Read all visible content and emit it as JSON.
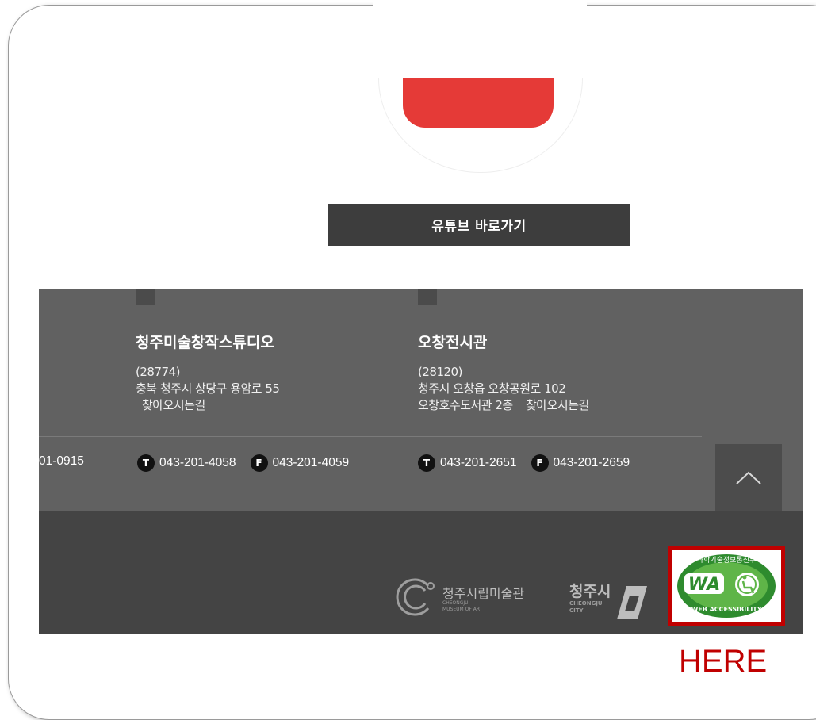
{
  "youtube": {
    "button_label": "유튜브 바로가기"
  },
  "venues": [
    {
      "name": "청주미술창작스튜디오",
      "postcode": "(28774)",
      "address_line": "충북 청주시 상당구 용암로 55",
      "directions": "찾아오시는길"
    },
    {
      "name": "오창전시관",
      "postcode": "(28120)",
      "address_line": "청주시 오창읍 오창공원로 102",
      "address_line2": "오창호수도서관 2층",
      "directions": "찾아오시는길"
    }
  ],
  "contacts": {
    "partial": "01-0915",
    "studio": {
      "tel": "043-201-4058",
      "fax": "043-201-4059"
    },
    "ochang": {
      "tel": "043-201-2651",
      "fax": "043-201-2659"
    },
    "tel_badge": "T",
    "fax_badge": "F"
  },
  "logos": {
    "museum_name": "청주시립미술관",
    "museum_en_1": "CHEONGJU",
    "museum_en_2": "MUSEUM OF ART",
    "city_name": "청주시",
    "city_en_1": "CHEONGJU",
    "city_en_2": "CITY"
  },
  "wa_mark": {
    "top_text": "과학기술정보통신부",
    "bottom_text": "WEB ACCESSIBILITY",
    "wa": "WA"
  },
  "annotation": {
    "label": "HERE",
    "color": "#c00000"
  }
}
